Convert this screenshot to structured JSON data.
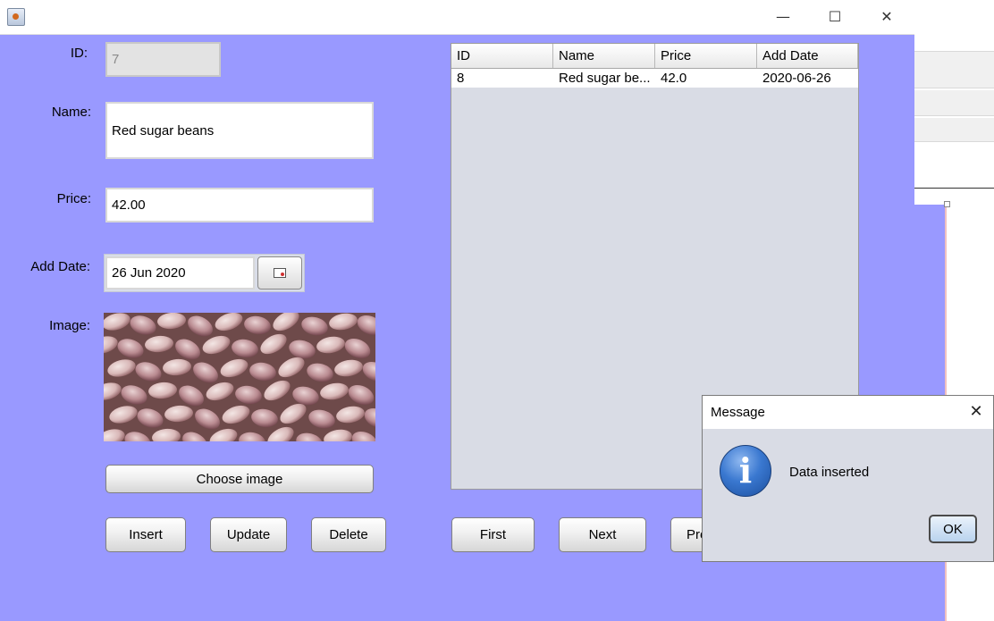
{
  "window": {
    "controls": {
      "minimize": "—",
      "maximize": "☐",
      "close": "✕"
    }
  },
  "form": {
    "id_label": "ID:",
    "id_value": "7",
    "name_label": "Name:",
    "name_value": "Red sugar beans",
    "price_label": "Price:",
    "price_value": "42.00",
    "date_label": "Add Date:",
    "date_value": "26 Jun 2020",
    "image_label": "Image:",
    "choose_image_label": "Choose image"
  },
  "buttons": {
    "insert": "Insert",
    "update": "Update",
    "delete": "Delete",
    "first": "First",
    "next": "Next",
    "previous": "Pre"
  },
  "table": {
    "columns": [
      "ID",
      "Name",
      "Price",
      "Add Date"
    ],
    "rows": [
      [
        "8",
        "Red sugar be...",
        "42.0",
        "2020-06-26"
      ]
    ]
  },
  "dialog": {
    "title": "Message",
    "message": "Data inserted",
    "ok_label": "OK"
  },
  "colors": {
    "panel_background": "#9999ff",
    "dialog_background": "#d9dce5"
  }
}
